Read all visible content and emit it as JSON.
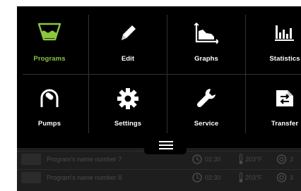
{
  "menu": {
    "items": [
      {
        "label": "Programs",
        "icon": "basin-icon",
        "active": true
      },
      {
        "label": "Edit",
        "icon": "pencil-icon"
      },
      {
        "label": "Graphs",
        "icon": "area-chart-icon"
      },
      {
        "label": "Statistics",
        "icon": "bar-chart-icon"
      },
      {
        "label": "Pumps",
        "icon": "pump-icon"
      },
      {
        "label": "Settings",
        "icon": "gear-icon"
      },
      {
        "label": "Service",
        "icon": "wrench-icon"
      },
      {
        "label": "Transfer",
        "icon": "transfer-icon"
      }
    ]
  },
  "programs": [
    {
      "name": "Program's name number 7",
      "time": "02:30",
      "temp": "203°F",
      "value": "3"
    },
    {
      "name": "Program's name number 8",
      "time": "02:30",
      "temp": "203°F",
      "value": "3"
    }
  ],
  "colors": {
    "accent": "#8cc63f",
    "panel": "#000000",
    "background": "#1e1e1e",
    "text": "#ffffff",
    "dim_text": "#4a4a4a"
  }
}
